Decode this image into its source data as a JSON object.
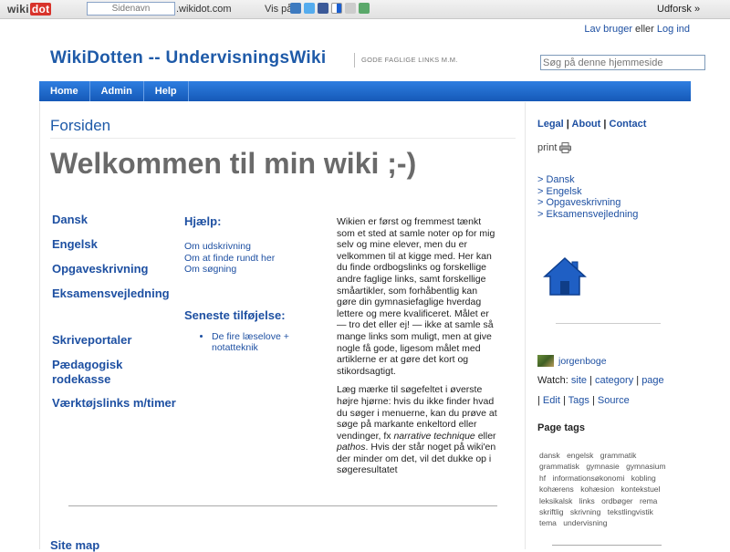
{
  "wikidot_bar": {
    "logo_text": "wiki",
    "logo_dot": "dot",
    "sitename_placeholder": "Sidenavn",
    "domain_suffix": ".wikidot.com",
    "share_label": "Vis på",
    "explore_label": "Udforsk »",
    "share_icons": [
      "digg-icon",
      "twitter-icon",
      "facebook-icon",
      "delicious-icon",
      "reddit-icon",
      "stumbleupon-icon"
    ]
  },
  "header": {
    "create_account": "Lav bruger",
    "or": "eller",
    "login": "Log ind",
    "site_title": "WikiDotten -- UndervisningsWiki",
    "subtitle": "GODE FAGLIGE LINKS M.M.",
    "search_placeholder": "Søg på denne hjemmeside"
  },
  "nav": {
    "items": [
      "Home",
      "Admin",
      "Help"
    ]
  },
  "page": {
    "title": "Forsiden",
    "welcome": "Welkommen til min wiki ;-)",
    "left_links": [
      "Dansk",
      "Engelsk",
      "Opgaveskrivning",
      "Eksamensvejledning",
      "Skriveportaler",
      "Pædagogisk rodekasse",
      "Værktøjslinks m/timer"
    ],
    "help_heading": "Hjælp:",
    "help_links": [
      "Om udskrivning",
      "Om at finde rundt her",
      "Om søgning"
    ],
    "recent_heading": "Seneste tilføjelse:",
    "recent_items": [
      "De fire læselove + notatteknik"
    ],
    "intro_p1": "Wikien er først og fremmest tænkt som et sted at samle noter op for mig selv og mine elever, men du er velkommen til at kigge med. Her kan du finde ordbogslinks og forskellige andre faglige links, samt forskellige småartikler, som forhåbentlig kan gøre din gymnasiefaglige hverdag lettere og mere kvalificeret. Målet er — tro det eller ej! — ikke at samle så mange links som muligt, men at give nogle få gode, ligesom målet med artiklerne er at gøre det kort og stikordsagtigt.",
    "intro_p2_a": "Læg mærke til søgefeltet i øverste højre hjørne: hvis du ikke finder hvad du søger i menuerne, kan du prøve at søge på markante enkeltord eller vendinger, fx ",
    "intro_p2_em1": "narrative technique",
    "intro_p2_b": " eller ",
    "intro_p2_em2": "pathos",
    "intro_p2_c": ". Hvis der står noget på wiki'en der minder om det, vil det dukke op i søgeresultatet",
    "sitemap": "Site map"
  },
  "sidebar": {
    "top_links": [
      "Legal",
      "About",
      "Contact"
    ],
    "print_label": "print",
    "subjects": [
      "> Dansk",
      "> Engelsk",
      "> Opgaveskrivning",
      "> Eksamensvejledning"
    ],
    "username": "jorgenboge",
    "watch_label": "Watch:",
    "watch_links": [
      "site",
      "category",
      "page"
    ],
    "edit_links": [
      "Edit",
      "Tags",
      "Source"
    ],
    "tags_heading": "Page tags",
    "tags": [
      "dansk",
      "engelsk",
      "grammatik",
      "grammatisk",
      "gymnasie",
      "gymnasium",
      "hf",
      "informationsøkonomi",
      "kobling",
      "kohærens",
      "kohæsion",
      "kontekstuel",
      "leksikalsk",
      "links",
      "ordbøger",
      "rema",
      "skriftlig",
      "skrivning",
      "tekstlingvistik",
      "tema",
      "undervisning"
    ]
  },
  "colors": {
    "link_blue": "#1e50a2",
    "nav_blue": "#1a66c9",
    "title_grey": "#6a6a6a"
  }
}
